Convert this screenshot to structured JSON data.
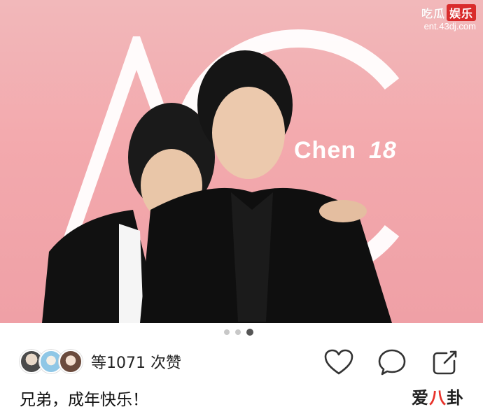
{
  "watermark": {
    "site_a": "吃瓜",
    "site_b": "娱乐",
    "url": "ent.43dj.com"
  },
  "photo": {
    "backdrop_text": "Chen",
    "backdrop_number": "18",
    "background_color": "#f2aeb2"
  },
  "pager": {
    "count": 3,
    "active": 2
  },
  "likes": {
    "avatars": [
      "avatar-1",
      "avatar-2",
      "avatar-3"
    ],
    "text": "等1071 次赞"
  },
  "actions": [
    {
      "name": "like-heart-icon"
    },
    {
      "name": "comment-bubble-icon"
    },
    {
      "name": "share-icon"
    }
  ],
  "caption": "兄弟，成年快乐！",
  "brand": {
    "part1": "爱",
    "part2": "八",
    "part3": "卦",
    "accent_color": "#e8322a"
  }
}
